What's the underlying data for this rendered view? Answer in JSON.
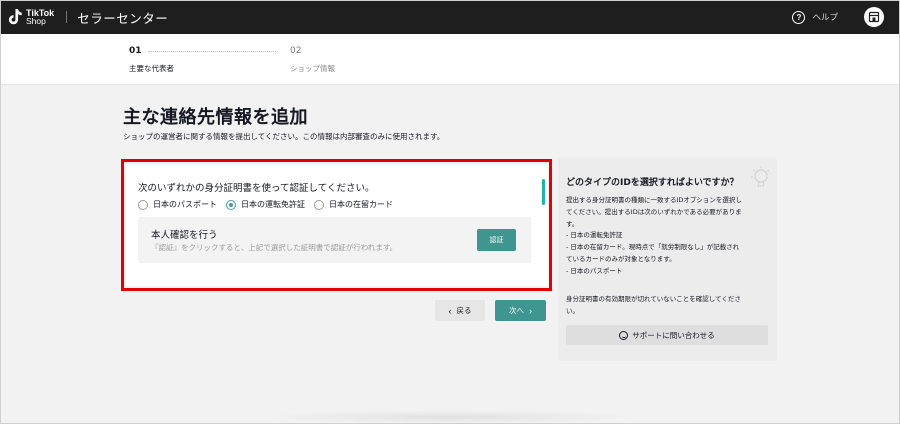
{
  "header": {
    "logo_line1": "TikTok",
    "logo_line2": "Shop",
    "title": "セラーセンター",
    "help_label": "ヘルプ",
    "icons": {
      "logo": "tiktok-logo-icon",
      "help": "question-circle-icon",
      "store": "store-icon"
    }
  },
  "stepper": {
    "steps": [
      {
        "number": "01",
        "label": "主要な代表者",
        "active": true
      },
      {
        "number": "02",
        "label": "ショップ情報",
        "active": false
      }
    ]
  },
  "page": {
    "title": "主な連絡先情報を追加",
    "subtitle": "ショップの運営者に関する情報を提出してください。この情報は内部審査のみに使用されます。"
  },
  "form": {
    "question": "次のいずれかの身分証明書を使って認証してください。",
    "options": [
      {
        "label": "日本のパスポート",
        "selected": false
      },
      {
        "label": "日本の運転免許証",
        "selected": true
      },
      {
        "label": "日本の在留カード",
        "selected": false
      }
    ],
    "verify": {
      "title": "本人確認を行う",
      "description": "『認証』をクリックすると、上記で選択した証明書で認証が行われます。",
      "button_label": "認証"
    }
  },
  "nav": {
    "back_label": "戻る",
    "next_label": "次へ"
  },
  "help_panel": {
    "title": "どのタイプのIDを選択すればよいですか？",
    "body_lines": [
      "提出する身分証明書の種類に一致するIDオプションを選択し",
      "てください。提出するIDは次のいずれかである必要がありま",
      "す。",
      "- 日本の運転免許証",
      "- 日本の在留カード。現時点で「就労制限なし」が記載され",
      "ているカードのみが対象となります。",
      "- 日本のパスポート"
    ],
    "note": "身分証明書の有効期限が切れていないことを確認してくださ\nい。",
    "note_line1": "身分証明書の有効期限が切れていないことを確認してくださ",
    "note_line2": "い。",
    "support_label": "サポートに問い合わせる"
  },
  "colors": {
    "accent": "#3f9690",
    "highlight": "#e00000",
    "topbar": "#1e1e1e"
  }
}
